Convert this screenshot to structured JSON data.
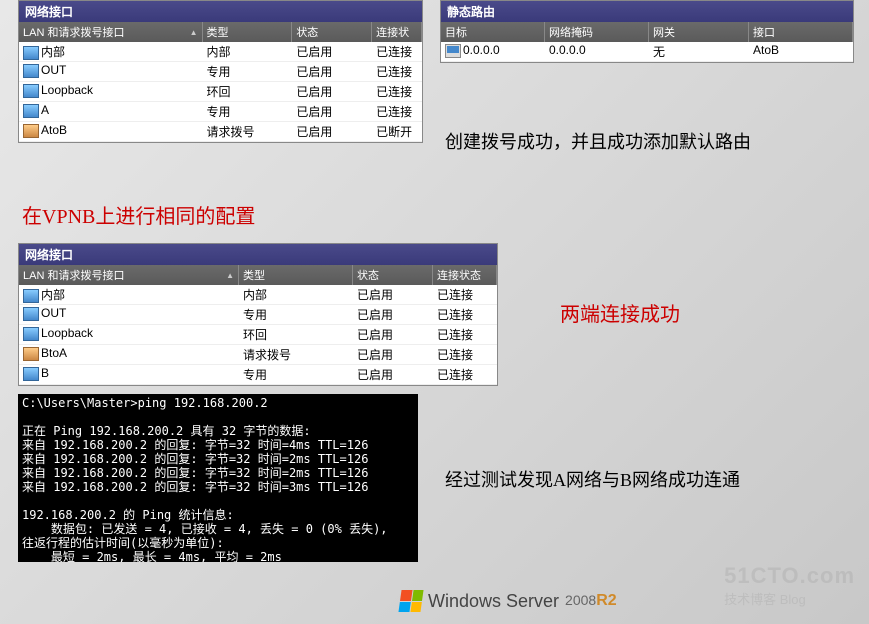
{
  "panel1": {
    "title": "网络接口",
    "headers": [
      "LAN 和请求拨号接口",
      "类型",
      "状态",
      "连接状"
    ],
    "rows": [
      {
        "icon": "lan",
        "name": "内部",
        "type": "内部",
        "status": "已启用",
        "conn": "已连接"
      },
      {
        "icon": "lan",
        "name": "OUT",
        "type": "专用",
        "status": "已启用",
        "conn": "已连接"
      },
      {
        "icon": "lan",
        "name": "Loopback",
        "type": "环回",
        "status": "已启用",
        "conn": "已连接"
      },
      {
        "icon": "lan",
        "name": "A",
        "type": "专用",
        "status": "已启用",
        "conn": "已连接"
      },
      {
        "icon": "dial",
        "name": "AtoB",
        "type": "请求拨号",
        "status": "已启用",
        "conn": "已断开"
      }
    ]
  },
  "panel2": {
    "title": "静态路由",
    "headers": [
      "目标",
      "网络掩码",
      "网关",
      "接口"
    ],
    "rows": [
      {
        "dest": "0.0.0.0",
        "mask": "0.0.0.0",
        "gw": "无",
        "iface": "AtoB"
      }
    ]
  },
  "panel3": {
    "title": "网络接口",
    "headers": [
      "LAN 和请求拨号接口",
      "类型",
      "状态",
      "连接状态"
    ],
    "rows": [
      {
        "icon": "lan",
        "name": "内部",
        "type": "内部",
        "status": "已启用",
        "conn": "已连接"
      },
      {
        "icon": "lan",
        "name": "OUT",
        "type": "专用",
        "status": "已启用",
        "conn": "已连接"
      },
      {
        "icon": "lan",
        "name": "Loopback",
        "type": "环回",
        "status": "已启用",
        "conn": "已连接"
      },
      {
        "icon": "dial",
        "name": "BtoA",
        "type": "请求拨号",
        "status": "已启用",
        "conn": "已连接"
      },
      {
        "icon": "lan",
        "name": "B",
        "type": "专用",
        "status": "已启用",
        "conn": "已连接"
      }
    ]
  },
  "terminal": {
    "prompt": "C:\\Users\\Master>ping 192.168.200.2",
    "lines": [
      "",
      "正在 Ping 192.168.200.2 具有 32 字节的数据:",
      "来自 192.168.200.2 的回复: 字节=32 时间=4ms TTL=126",
      "来自 192.168.200.2 的回复: 字节=32 时间=2ms TTL=126",
      "来自 192.168.200.2 的回复: 字节=32 时间=2ms TTL=126",
      "来自 192.168.200.2 的回复: 字节=32 时间=3ms TTL=126",
      "",
      "192.168.200.2 的 Ping 统计信息:",
      "    数据包: 已发送 = 4, 已接收 = 4, 丢失 = 0 (0% 丢失),",
      "往返行程的估计时间(以毫秒为单位):",
      "    最短 = 2ms, 最长 = 4ms, 平均 = 2ms"
    ]
  },
  "annotations": {
    "a1": "在VPNB上进行相同的配置",
    "a2": "创建拨号成功，并且成功添加默认路由",
    "a3": "两端连接成功",
    "a4": "经过测试发现A网络与B网络成功连通"
  },
  "logo": {
    "brand": "Windows Server",
    "year": "2008",
    "r2": "R2"
  },
  "watermark": {
    "line1": "51CTO.com",
    "line2": "技术博客     Blog"
  }
}
